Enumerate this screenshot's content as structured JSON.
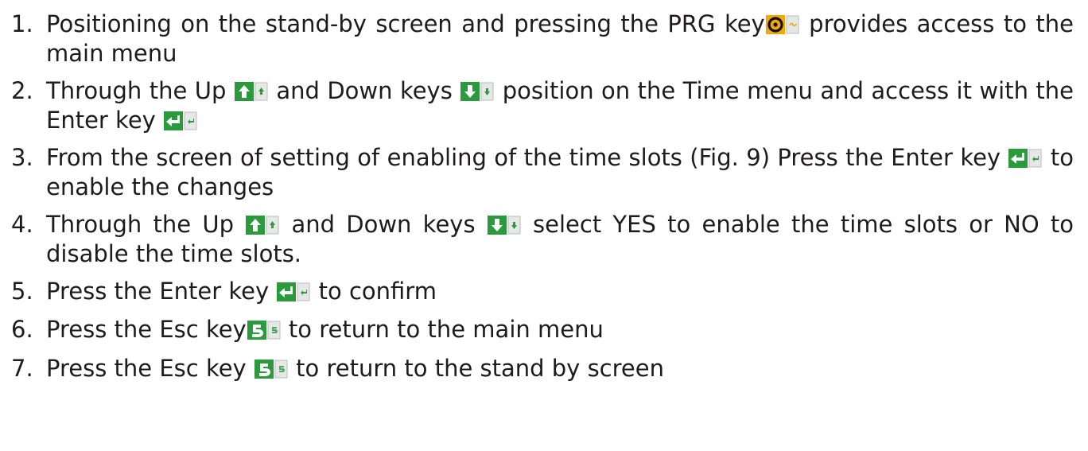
{
  "colors": {
    "text": "#1d1b1b",
    "key_green": "#2a9a3c",
    "key_light": "#e6e8e8",
    "prg_orange": "#f2a800",
    "prg_black": "#111111"
  },
  "steps": [
    {
      "number": "1.",
      "parts": [
        {
          "type": "text",
          "value": "Positioning on the stand-by screen and pressing the PRG key"
        },
        {
          "type": "icon",
          "icon": "prg-key-icon"
        },
        {
          "type": "text",
          "value": " provides access to the main menu"
        }
      ]
    },
    {
      "number": "2.",
      "parts": [
        {
          "type": "text",
          "value": "Through the Up "
        },
        {
          "type": "icon",
          "icon": "up-key-icon"
        },
        {
          "type": "text",
          "value": " and Down keys "
        },
        {
          "type": "icon",
          "icon": "down-key-icon"
        },
        {
          "type": "text",
          "value": " position on the Time menu and access it with the Enter key "
        },
        {
          "type": "icon",
          "icon": "enter-key-icon"
        }
      ]
    },
    {
      "number": "3.",
      "parts": [
        {
          "type": "text",
          "value": "From the screen of setting of enabling of the time slots (Fig. 9) Press the Enter key "
        },
        {
          "type": "icon",
          "icon": "enter-key-icon"
        },
        {
          "type": "text",
          "value": " to enable the changes"
        }
      ]
    },
    {
      "number": "4.",
      "parts": [
        {
          "type": "text",
          "value": "Through the Up "
        },
        {
          "type": "icon",
          "icon": "up-key-icon"
        },
        {
          "type": "text",
          "value": "  and Down keys "
        },
        {
          "type": "icon",
          "icon": "down-key-icon"
        },
        {
          "type": "text",
          "value": " select YES to enable the time slots or NO to disable the time slots."
        }
      ]
    },
    {
      "number": "5.",
      "parts": [
        {
          "type": "text",
          "value": "Press the Enter key  "
        },
        {
          "type": "icon",
          "icon": "enter-key-icon"
        },
        {
          "type": "text",
          "value": " to confirm"
        }
      ]
    },
    {
      "number": "6.",
      "parts": [
        {
          "type": "text",
          "value": "Press the Esc key"
        },
        {
          "type": "icon",
          "icon": "esc-key-icon"
        },
        {
          "type": "text",
          "value": " to return to the main menu"
        }
      ]
    },
    {
      "number": "7.",
      "parts": [
        {
          "type": "text",
          "value": "Press the Esc key "
        },
        {
          "type": "icon",
          "icon": "esc-key-icon"
        },
        {
          "type": "text",
          "value": " to return to the stand by screen"
        }
      ]
    }
  ]
}
